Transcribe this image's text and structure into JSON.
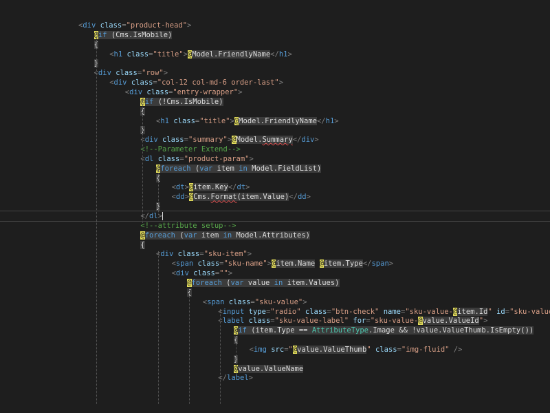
{
  "editor": {
    "title": "Code editor",
    "lines": [
      {
        "indent": 0,
        "tokens": [
          [
            "punc",
            "<"
          ],
          [
            "tag",
            "div"
          ],
          [
            "text",
            " "
          ],
          [
            "attr",
            "class"
          ],
          [
            "punc",
            "="
          ],
          [
            "str",
            "\"product-head\""
          ],
          [
            "punc",
            ">"
          ]
        ]
      },
      {
        "indent": 1,
        "tokens": [
          [
            "at",
            "@"
          ],
          [
            "kwbg",
            "if"
          ],
          [
            "rzbg",
            " (Cms.IsMobile)"
          ]
        ]
      },
      {
        "indent": 1,
        "tokens": [
          [
            "rzbg",
            "{"
          ]
        ]
      },
      {
        "indent": 2,
        "tokens": [
          [
            "punc",
            "<"
          ],
          [
            "tag",
            "h1"
          ],
          [
            "text",
            " "
          ],
          [
            "attr",
            "class"
          ],
          [
            "punc",
            "="
          ],
          [
            "str",
            "\"title\""
          ],
          [
            "punc",
            ">"
          ],
          [
            "at",
            "@"
          ],
          [
            "rzbg",
            "Model.FriendlyName"
          ],
          [
            "punc",
            "</"
          ],
          [
            "tag",
            "h1"
          ],
          [
            "punc",
            ">"
          ]
        ]
      },
      {
        "indent": 1,
        "tokens": [
          [
            "rzbg",
            "}"
          ]
        ]
      },
      {
        "indent": 1,
        "tokens": [
          [
            "punc",
            "<"
          ],
          [
            "tag",
            "div"
          ],
          [
            "text",
            " "
          ],
          [
            "attr",
            "class"
          ],
          [
            "punc",
            "="
          ],
          [
            "str",
            "\"row\""
          ],
          [
            "punc",
            ">"
          ]
        ]
      },
      {
        "indent": 2,
        "tokens": [
          [
            "punc",
            "<"
          ],
          [
            "tag",
            "div"
          ],
          [
            "text",
            " "
          ],
          [
            "attr",
            "class"
          ],
          [
            "punc",
            "="
          ],
          [
            "str",
            "\"col-12 col-md-6 order-last\""
          ],
          [
            "punc",
            ">"
          ]
        ]
      },
      {
        "indent": 3,
        "tokens": [
          [
            "punc",
            "<"
          ],
          [
            "tag",
            "div"
          ],
          [
            "text",
            " "
          ],
          [
            "attr",
            "class"
          ],
          [
            "punc",
            "="
          ],
          [
            "str",
            "\"entry-wrapper\""
          ],
          [
            "punc",
            ">"
          ]
        ]
      },
      {
        "indent": 4,
        "tokens": [
          [
            "at",
            "@"
          ],
          [
            "kwbg",
            "if"
          ],
          [
            "rzbg",
            " (!Cms.IsMobile)"
          ]
        ]
      },
      {
        "indent": 4,
        "tokens": [
          [
            "rzbg",
            "{"
          ]
        ]
      },
      {
        "indent": 5,
        "tokens": [
          [
            "punc",
            "<"
          ],
          [
            "tag",
            "h1"
          ],
          [
            "text",
            " "
          ],
          [
            "attr",
            "class"
          ],
          [
            "punc",
            "="
          ],
          [
            "str",
            "\"title\""
          ],
          [
            "punc",
            ">"
          ],
          [
            "at",
            "@"
          ],
          [
            "rzbg",
            "Model.FriendlyName"
          ],
          [
            "punc",
            "</"
          ],
          [
            "tag",
            "h1"
          ],
          [
            "punc",
            ">"
          ]
        ]
      },
      {
        "indent": 4,
        "tokens": [
          [
            "rzbg",
            "}"
          ]
        ]
      },
      {
        "indent": 4,
        "tokens": [
          [
            "punc",
            "<"
          ],
          [
            "tag",
            "div"
          ],
          [
            "text",
            " "
          ],
          [
            "attr",
            "class"
          ],
          [
            "punc",
            "="
          ],
          [
            "str",
            "\"summary\""
          ],
          [
            "punc",
            ">"
          ],
          [
            "at",
            "@"
          ],
          [
            "rzbg",
            "Model."
          ],
          [
            "rzsq",
            "Summary"
          ],
          [
            "punc",
            "</"
          ],
          [
            "tag",
            "div"
          ],
          [
            "punc",
            ">"
          ]
        ]
      },
      {
        "indent": 4,
        "tokens": [
          [
            "cm",
            "<!--Parameter Extend-->"
          ]
        ]
      },
      {
        "indent": 4,
        "tokens": [
          [
            "punc",
            "<"
          ],
          [
            "tag",
            "dl"
          ],
          [
            "text",
            " "
          ],
          [
            "attr",
            "class"
          ],
          [
            "punc",
            "="
          ],
          [
            "str",
            "\"product-param\""
          ],
          [
            "punc",
            ">"
          ]
        ]
      },
      {
        "indent": 5,
        "tokens": [
          [
            "at",
            "@"
          ],
          [
            "kwbg",
            "foreach"
          ],
          [
            "rzbg",
            " ("
          ],
          [
            "kwbg",
            "var"
          ],
          [
            "rzbg",
            " item "
          ],
          [
            "kwbg",
            "in"
          ],
          [
            "rzbg",
            " Model.FieldList)"
          ]
        ]
      },
      {
        "indent": 5,
        "tokens": [
          [
            "rzbg",
            "{"
          ]
        ]
      },
      {
        "indent": 6,
        "tokens": [
          [
            "punc",
            "<"
          ],
          [
            "tag",
            "dt"
          ],
          [
            "punc",
            ">"
          ],
          [
            "at",
            "@"
          ],
          [
            "rzbg",
            "item.Key"
          ],
          [
            "punc",
            "</"
          ],
          [
            "tag",
            "dt"
          ],
          [
            "punc",
            ">"
          ]
        ]
      },
      {
        "indent": 6,
        "tokens": [
          [
            "punc",
            "<"
          ],
          [
            "tag",
            "dd"
          ],
          [
            "punc",
            ">"
          ],
          [
            "at",
            "@"
          ],
          [
            "rzbg",
            "Cms."
          ],
          [
            "rzsq",
            "Format"
          ],
          [
            "rzbg",
            "(item.Value)"
          ],
          [
            "punc",
            "</"
          ],
          [
            "tag",
            "dd"
          ],
          [
            "punc",
            ">"
          ]
        ]
      },
      {
        "indent": 5,
        "tokens": [
          [
            "rzbg",
            "}"
          ]
        ]
      },
      {
        "indent": 4,
        "current": true,
        "tokens": [
          [
            "punc",
            "</"
          ],
          [
            "tag",
            "dl"
          ],
          [
            "punc",
            ">"
          ],
          [
            "caret",
            ""
          ]
        ]
      },
      {
        "indent": 4,
        "tokens": [
          [
            "cm",
            "<!--attribute setup-->"
          ]
        ]
      },
      {
        "indent": 4,
        "tokens": [
          [
            "at",
            "@"
          ],
          [
            "kwbg",
            "foreach"
          ],
          [
            "rzbg",
            " ("
          ],
          [
            "kwbg",
            "var"
          ],
          [
            "rzbg",
            " item "
          ],
          [
            "kwbg",
            "in"
          ],
          [
            "rzbg",
            " Model.Attributes)"
          ]
        ]
      },
      {
        "indent": 4,
        "tokens": [
          [
            "rzbg",
            "{"
          ]
        ]
      },
      {
        "indent": 5,
        "tokens": [
          [
            "punc",
            "<"
          ],
          [
            "tag",
            "div"
          ],
          [
            "text",
            " "
          ],
          [
            "attr",
            "class"
          ],
          [
            "punc",
            "="
          ],
          [
            "str",
            "\"sku-item\""
          ],
          [
            "punc",
            ">"
          ]
        ]
      },
      {
        "indent": 6,
        "tokens": [
          [
            "punc",
            "<"
          ],
          [
            "tag",
            "span"
          ],
          [
            "text",
            " "
          ],
          [
            "attr",
            "class"
          ],
          [
            "punc",
            "="
          ],
          [
            "str",
            "\"sku-name\""
          ],
          [
            "punc",
            ">"
          ],
          [
            "at",
            "@"
          ],
          [
            "rzbg",
            "item.Name"
          ],
          [
            "text",
            " "
          ],
          [
            "at",
            "@"
          ],
          [
            "rzbg",
            "item.Type"
          ],
          [
            "punc",
            "</"
          ],
          [
            "tag",
            "span"
          ],
          [
            "punc",
            ">"
          ]
        ]
      },
      {
        "indent": 6,
        "tokens": [
          [
            "punc",
            "<"
          ],
          [
            "tag",
            "div"
          ],
          [
            "text",
            " "
          ],
          [
            "attr",
            "class"
          ],
          [
            "punc",
            "="
          ],
          [
            "str",
            "\"\""
          ],
          [
            "punc",
            ">"
          ]
        ]
      },
      {
        "indent": 7,
        "tokens": [
          [
            "at",
            "@"
          ],
          [
            "kwbg",
            "foreach"
          ],
          [
            "rzbg",
            " ("
          ],
          [
            "kwbg",
            "var"
          ],
          [
            "rzbg",
            " value "
          ],
          [
            "kwbg",
            "in"
          ],
          [
            "rzbg",
            " item.Values)"
          ]
        ]
      },
      {
        "indent": 7,
        "tokens": [
          [
            "rzbg",
            "{"
          ]
        ]
      },
      {
        "indent": 8,
        "tokens": [
          [
            "punc",
            "<"
          ],
          [
            "tag",
            "span"
          ],
          [
            "text",
            " "
          ],
          [
            "attr",
            "class"
          ],
          [
            "punc",
            "="
          ],
          [
            "str",
            "\"sku-value\""
          ],
          [
            "punc",
            ">"
          ]
        ]
      },
      {
        "indent": 9,
        "tokens": [
          [
            "punc",
            "<"
          ],
          [
            "tag",
            "input"
          ],
          [
            "text",
            " "
          ],
          [
            "attr",
            "type"
          ],
          [
            "punc",
            "="
          ],
          [
            "str",
            "\"radio\""
          ],
          [
            "text",
            " "
          ],
          [
            "attr",
            "class"
          ],
          [
            "punc",
            "="
          ],
          [
            "str",
            "\"btn-check\""
          ],
          [
            "text",
            " "
          ],
          [
            "attr",
            "name"
          ],
          [
            "punc",
            "="
          ],
          [
            "str",
            "\"sku-value-"
          ],
          [
            "at",
            "@"
          ],
          [
            "rzbg",
            "item.Id"
          ],
          [
            "str",
            "\""
          ],
          [
            "text",
            " "
          ],
          [
            "attr",
            "id"
          ],
          [
            "punc",
            "="
          ],
          [
            "str",
            "\"sku-value-"
          ],
          [
            "at",
            "@"
          ],
          [
            "rzbg",
            "value.V"
          ]
        ]
      },
      {
        "indent": 9,
        "tokens": [
          [
            "punc",
            "<"
          ],
          [
            "tag",
            "label"
          ],
          [
            "text",
            " "
          ],
          [
            "attr",
            "class"
          ],
          [
            "punc",
            "="
          ],
          [
            "str",
            "\"sku-value-label\""
          ],
          [
            "text",
            " "
          ],
          [
            "attr",
            "for"
          ],
          [
            "punc",
            "="
          ],
          [
            "str",
            "\"sku-value-"
          ],
          [
            "at",
            "@"
          ],
          [
            "rzbg",
            "value.ValueId"
          ],
          [
            "str",
            "\""
          ],
          [
            "punc",
            ">"
          ]
        ]
      },
      {
        "indent": 10,
        "tokens": [
          [
            "at",
            "@"
          ],
          [
            "kwbg",
            "if"
          ],
          [
            "rzbg",
            " (item.Type == "
          ],
          [
            "typebg",
            "AttributeType"
          ],
          [
            "rzbg",
            ".Image && !value.ValueThumb.IsEmpty())"
          ]
        ]
      },
      {
        "indent": 10,
        "tokens": [
          [
            "rzbg",
            "{"
          ]
        ]
      },
      {
        "indent": 11,
        "tokens": [
          [
            "punc",
            "<"
          ],
          [
            "tag",
            "img"
          ],
          [
            "text",
            " "
          ],
          [
            "attr",
            "src"
          ],
          [
            "punc",
            "="
          ],
          [
            "str",
            "\""
          ],
          [
            "at",
            "@"
          ],
          [
            "rzbg",
            "value.ValueThumb"
          ],
          [
            "str",
            "\""
          ],
          [
            "text",
            " "
          ],
          [
            "attr",
            "class"
          ],
          [
            "punc",
            "="
          ],
          [
            "str",
            "\"img-fluid\""
          ],
          [
            "text",
            " "
          ],
          [
            "punc",
            "/>"
          ]
        ]
      },
      {
        "indent": 10,
        "tokens": [
          [
            "rzbg",
            "}"
          ]
        ]
      },
      {
        "indent": 10,
        "tokens": [
          [
            "at",
            "@"
          ],
          [
            "rzbg",
            "value.ValueName"
          ]
        ]
      },
      {
        "indent": 9,
        "tokens": [
          [
            "punc",
            "</"
          ],
          [
            "tag",
            "label"
          ],
          [
            "punc",
            ">"
          ]
        ]
      }
    ]
  }
}
